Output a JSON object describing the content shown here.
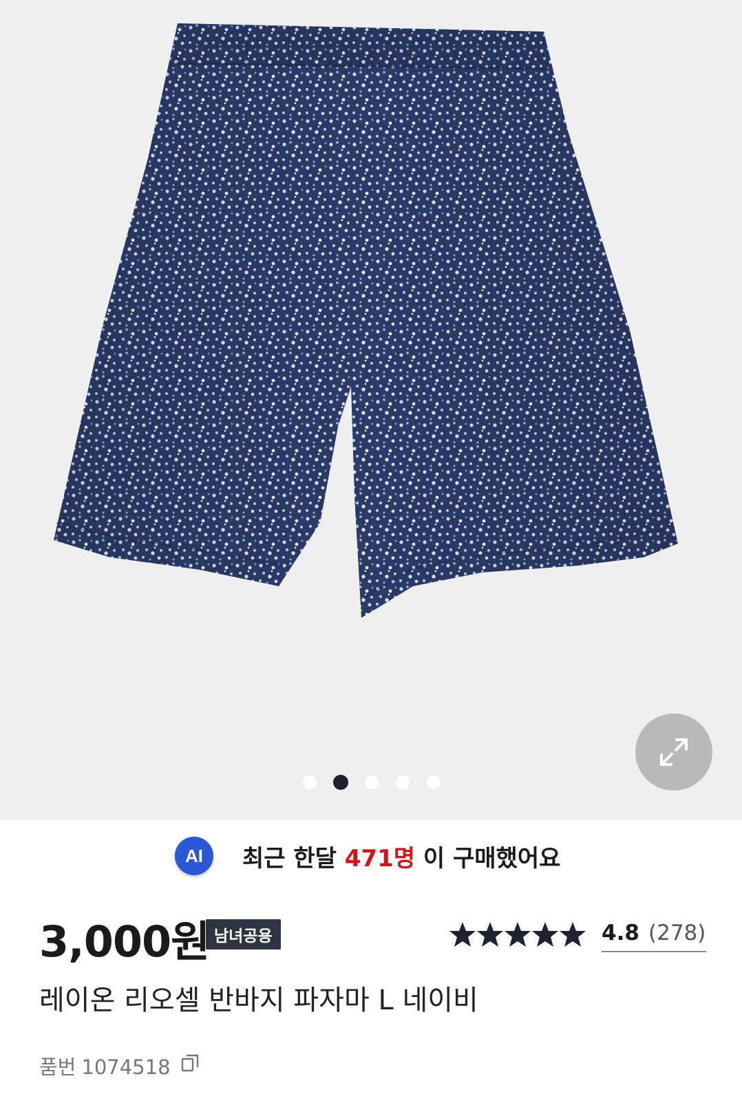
{
  "gallery": {
    "product_image_alt": "레이온 리오셀 반바지 파자마 L 네이비",
    "slide_count": 5,
    "active_slide_index": 1,
    "expand_icon": "expand-icon"
  },
  "ai_banner": {
    "badge": "AI",
    "prefix": "최근 한달 ",
    "count": "471명",
    "suffix": " 이 구매했어요"
  },
  "product": {
    "price": "3,000원",
    "tag": "남녀공용",
    "rating": {
      "stars_filled": 5,
      "score": "4.8",
      "review_count": "(278)"
    },
    "title": "레이온 리오셀 반바지 파자마 L 네이비",
    "sku_label": "품번",
    "sku": "1074518",
    "copy_icon": "copy-icon"
  },
  "colors": {
    "gallery_bg": "#efefef",
    "accent_red": "#d3121a",
    "ai_blue": "#2a57d6",
    "tag_bg": "#2e3441",
    "fabric_navy": "#2c3a66"
  }
}
